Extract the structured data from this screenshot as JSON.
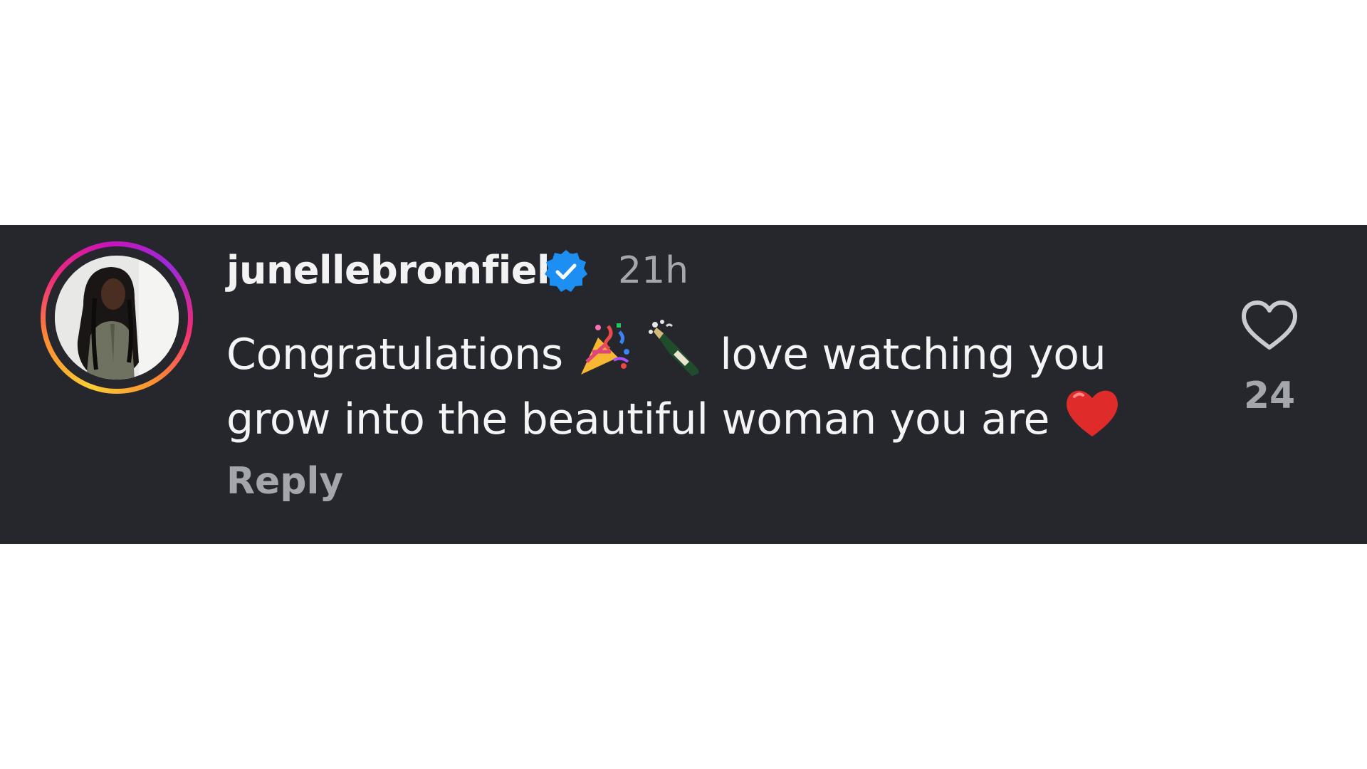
{
  "comment": {
    "username": "junellebromfield",
    "verified": true,
    "timestamp": "21h",
    "text_line1_before": "Congratulations",
    "text_line1_after": "love watching you",
    "text_line2": "grow into the beautiful woman you are",
    "reply_label": "Reply",
    "like_count": "24"
  },
  "icons": {
    "verified": "verified-badge-icon",
    "party": "party-popper-emoji",
    "champagne": "champagne-bottle-emoji",
    "heart_emoji": "red-heart-emoji",
    "like": "heart-outline-icon"
  },
  "colors": {
    "card_background": "#25272c",
    "verified_blue": "#1d8ff2",
    "muted_text": "#a3a6ad"
  }
}
